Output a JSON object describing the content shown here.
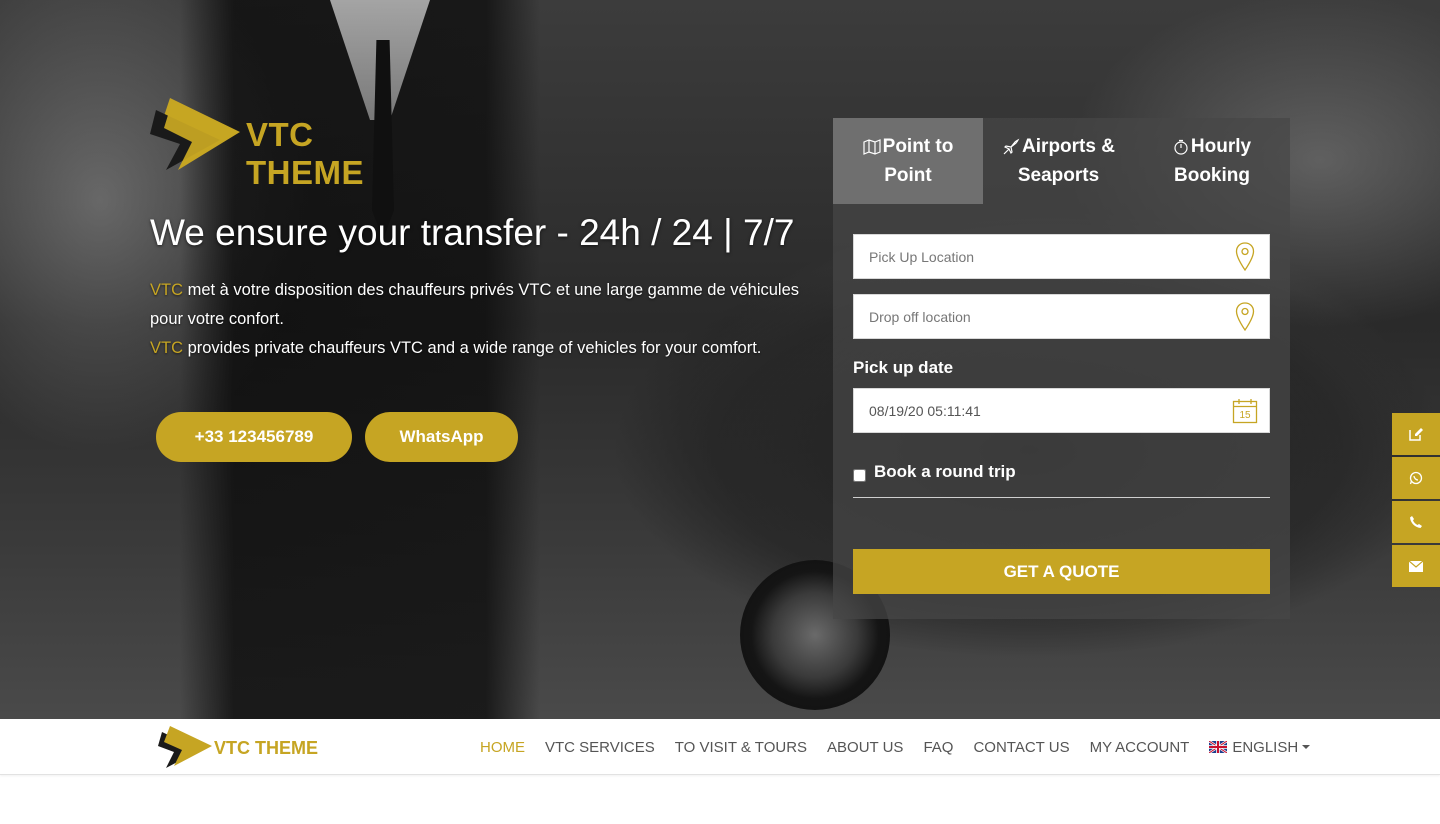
{
  "brand": {
    "name": "VTC THEME",
    "accent": "#c6a523"
  },
  "hero": {
    "headline": "We ensure your transfer - 24h / 24 | 7/7",
    "fr_highlight": "VTC",
    "fr_text": " met à votre disposition des chauffeurs privés VTC et une large gamme de véhicules pour votre confort.",
    "en_highlight": "VTC",
    "en_text": " provides private chauffeurs VTC and a wide range of vehicles for your comfort.",
    "phone_button": "+33 123456789",
    "whatsapp_button": "WhatsApp"
  },
  "booking": {
    "tabs": [
      {
        "line1": "Point to",
        "line2": "Point",
        "icon": "map-icon"
      },
      {
        "line1": "Airports &",
        "line2": "Seaports",
        "icon": "plane-icon"
      },
      {
        "line1": "Hourly",
        "line2": "Booking",
        "icon": "clock-icon"
      }
    ],
    "active_tab": 0,
    "pickup_placeholder": "Pick Up Location",
    "dropoff_placeholder": "Drop off location",
    "date_label": "Pick up date",
    "date_value": "08/19/20 05:11:41",
    "calendar_day": "15",
    "round_trip_label": "Book a round trip",
    "quote_button": "GET A QUOTE"
  },
  "side_contact": [
    "edit-icon",
    "whatsapp-icon",
    "phone-icon",
    "envelope-icon"
  ],
  "nav": {
    "items": [
      "HOME",
      "VTC SERVICES",
      "TO VISIT & TOURS",
      "ABOUT US",
      "FAQ",
      "CONTACT US",
      "MY ACCOUNT"
    ],
    "language": "ENGLISH",
    "active": "HOME"
  }
}
